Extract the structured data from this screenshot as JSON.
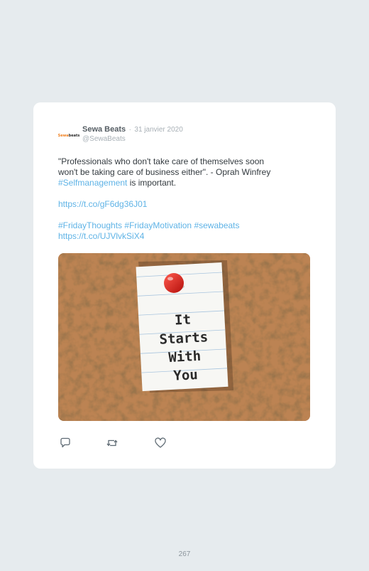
{
  "tweet": {
    "avatar_text_a": "Sewa",
    "avatar_text_b": "beats",
    "name": "Sewa Beats",
    "separator": "·",
    "date": "31 janvier 2020",
    "handle": "@SewaBeats",
    "quote_line1": "\"Professionals who don't take care of themselves soon",
    "quote_line2": "won't be taking care of business either\". - Oprah Winfrey",
    "hashtag_selfmanagement": "#Selfmanagement",
    "important_text": " is important.",
    "link1": "https://t.co/gF6dg36J01",
    "hashtag_friday_thoughts": "#FridayThoughts",
    "hashtag_friday_motivation": "#FridayMotivation",
    "hashtag_sewabeats": "#sewabeats",
    "link2": "https://t.co/UJVlvkSiX4",
    "image_note_text": [
      "It",
      "Starts",
      "With",
      "You"
    ],
    "link_color": "#5fb3e6"
  },
  "actions": {
    "reply_icon": "reply-icon",
    "retweet_icon": "retweet-icon",
    "like_icon": "heart-icon"
  },
  "footer": {
    "page_number": "267"
  }
}
